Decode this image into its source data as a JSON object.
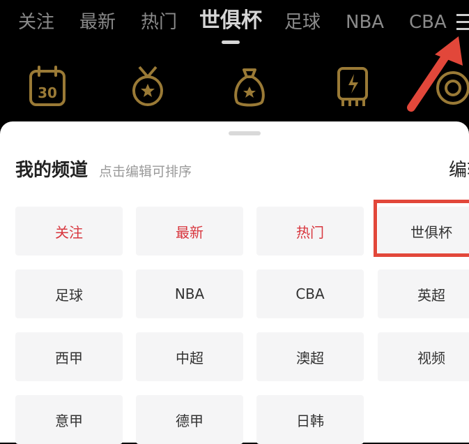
{
  "tabs": [
    {
      "label": "关注",
      "active": false
    },
    {
      "label": "最新",
      "active": false
    },
    {
      "label": "热门",
      "active": false
    },
    {
      "label": "世俱杯",
      "active": true
    },
    {
      "label": "足球",
      "active": false
    },
    {
      "label": "NBA",
      "active": false
    },
    {
      "label": "CBA",
      "active": false
    }
  ],
  "quick_icons": [
    {
      "name": "calendar-icon",
      "text": "30"
    },
    {
      "name": "medal-icon"
    },
    {
      "name": "money-bag-icon"
    },
    {
      "name": "lightning-card-icon"
    },
    {
      "name": "badge-icon"
    }
  ],
  "colors": {
    "accent_gold": "#9a7a36",
    "highlight_red": "#e2473a",
    "chip_red_text": "#d8363e"
  },
  "channels": {
    "title": "我的频道",
    "hint": "点击编辑可排序",
    "edit_label": "编辑",
    "items": [
      {
        "label": "关注",
        "red": true
      },
      {
        "label": "最新",
        "red": true
      },
      {
        "label": "热门",
        "red": true
      },
      {
        "label": "世俱杯",
        "red": false
      },
      {
        "label": "足球",
        "red": false
      },
      {
        "label": "NBA",
        "red": false
      },
      {
        "label": "CBA",
        "red": false
      },
      {
        "label": "英超",
        "red": false
      },
      {
        "label": "西甲",
        "red": false
      },
      {
        "label": "中超",
        "red": false
      },
      {
        "label": "澳超",
        "red": false
      },
      {
        "label": "视频",
        "red": false
      },
      {
        "label": "意甲",
        "red": false
      },
      {
        "label": "德甲",
        "red": false
      },
      {
        "label": "日韩",
        "red": false
      }
    ]
  }
}
